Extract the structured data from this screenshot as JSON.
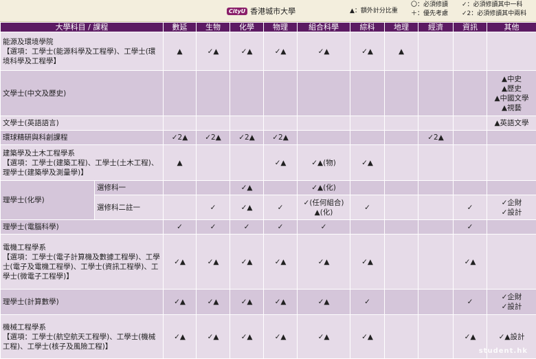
{
  "header": {
    "logo_mark": "CityU",
    "university": "香港城市大學",
    "legend": {
      "extra_points": "▲：額外計分比重",
      "compulsory": "〇：必須修讀",
      "priority": "＋：優先考慮",
      "one_of": "✓：必須修讀其中一科",
      "two_of": "✓2：必須修讀其中兩科"
    }
  },
  "columns": [
    "大學科目 / 課程",
    "數延",
    "生物",
    "化學",
    "物理",
    "組合科學",
    "綜科",
    "地理",
    "經濟",
    "資訊",
    "其他"
  ],
  "rows": [
    {
      "name": "能源及環境學院\n【選項：工學士(能源科學及工程學)、工學士(環境科學及工程學】",
      "cells": [
        "▲",
        "✓▲",
        "✓▲",
        "✓▲",
        "✓▲",
        "✓▲",
        "▲",
        "",
        "",
        ""
      ]
    },
    {
      "name": "文學士(中文及歷史)",
      "cells": [
        "",
        "",
        "",
        "",
        "",
        "",
        "",
        "",
        "",
        "▲中史\n▲歷史\n▲中國文學\n▲視藝"
      ]
    },
    {
      "name": "文學士(英語語言)",
      "cells": [
        "",
        "",
        "",
        "",
        "",
        "",
        "",
        "",
        "",
        "▲英語文學"
      ]
    },
    {
      "name": "環球精研與科創課程",
      "cells": [
        "✓2▲",
        "✓2▲",
        "✓2▲",
        "✓2▲",
        "",
        "",
        "",
        "✓2▲",
        "",
        ""
      ]
    },
    {
      "name": "建築學及土木工程學系\n【選項：工學士(建築工程)、工學士(土木工程)、理學士(建築學及測量學)】",
      "cells": [
        "▲",
        "",
        "",
        "✓▲",
        "✓▲(物)",
        "✓▲",
        "",
        "",
        "",
        ""
      ]
    },
    {
      "name": "理學士(化學)",
      "sub": "選修科一",
      "cells": [
        "",
        "",
        "✓▲",
        "",
        "✓▲(化)",
        "",
        "",
        "",
        "",
        ""
      ]
    },
    {
      "sub": "選修科二註一",
      "cells": [
        "",
        "✓",
        "✓▲",
        "✓",
        "✓(任何組合)\n▲(化)",
        "✓",
        "",
        "",
        "✓",
        "✓企財\n✓設計"
      ]
    },
    {
      "name": "理學士(電腦科學)",
      "cells": [
        "✓",
        "✓",
        "✓",
        "✓",
        "✓",
        "",
        "",
        "",
        "✓",
        ""
      ]
    },
    {
      "name": "電機工程學系\n【選項：工學士(電子計算機及數據工程學)、工學士(電子及電機工程學)、工學士(資訊工程學)、工學士(微電子工程學)】",
      "cells": [
        "✓▲",
        "✓▲",
        "✓▲",
        "✓▲",
        "✓▲",
        "✓▲",
        "",
        "",
        "✓▲",
        ""
      ]
    },
    {
      "name": "理學士(計算數學)",
      "cells": [
        "✓▲",
        "✓▲",
        "✓▲",
        "✓▲",
        "✓▲",
        "✓",
        "",
        "",
        "✓",
        "✓企財\n✓設計"
      ]
    },
    {
      "name": "機械工程學系\n【選項：工學士(航空航天工程學)、工學士(機械工程)、工學士(核子及風險工程)】",
      "cells": [
        "✓▲",
        "✓▲",
        "✓▲",
        "✓▲",
        "✓▲",
        "✓▲",
        "",
        "",
        "✓▲",
        "✓▲設計"
      ]
    }
  ],
  "watermark": "student.hk"
}
